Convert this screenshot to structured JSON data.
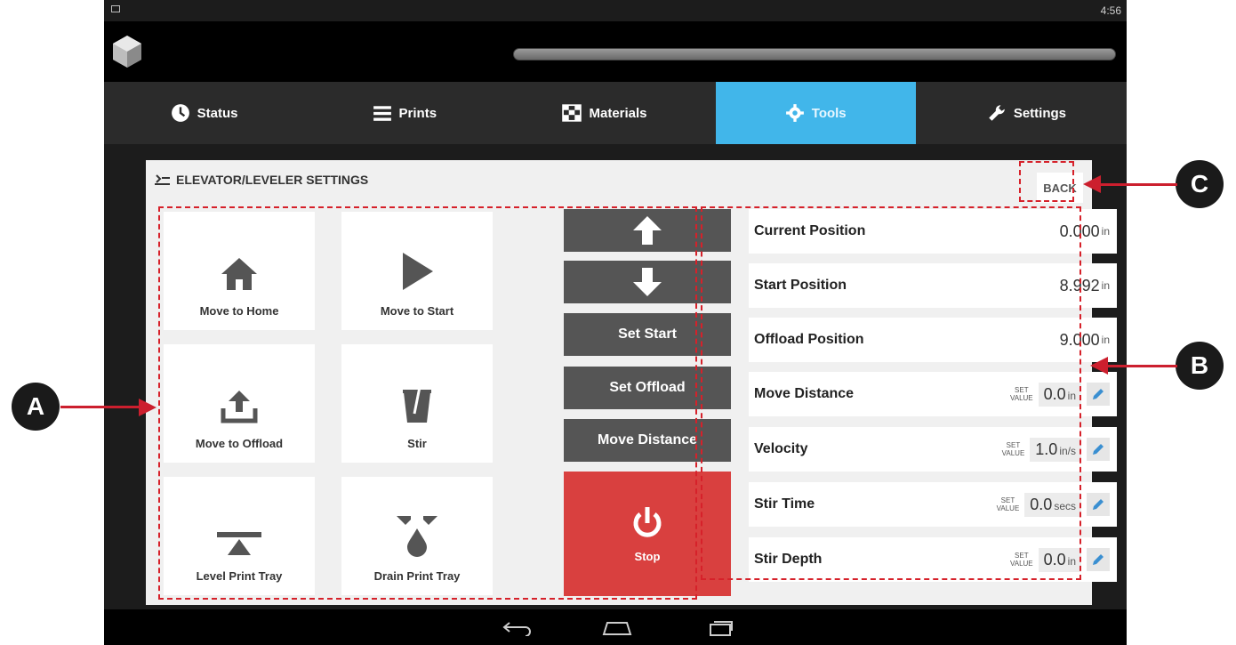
{
  "status_bar": {
    "time": "4:56"
  },
  "tabs": [
    {
      "label": "Status",
      "icon": "clock-icon"
    },
    {
      "label": "Prints",
      "icon": "menu-icon"
    },
    {
      "label": "Materials",
      "icon": "checkered-flag-icon"
    },
    {
      "label": "Tools",
      "icon": "gear-icon",
      "active": true
    },
    {
      "label": "Settings",
      "icon": "wrench-icon"
    }
  ],
  "panel": {
    "title": "ELEVATOR/LEVELER SETTINGS",
    "back_label": "BACK"
  },
  "tiles": [
    {
      "label": "Move to Home",
      "icon": "home-icon"
    },
    {
      "label": "Move to Start",
      "icon": "play-icon"
    },
    {
      "label": "Move to Offload",
      "icon": "upload-icon"
    },
    {
      "label": "Stir",
      "icon": "cup-icon"
    },
    {
      "label": "Level Print Tray",
      "icon": "level-icon"
    },
    {
      "label": "Drain Print Tray",
      "icon": "drain-icon"
    }
  ],
  "controls": {
    "up_icon": "arrow-up-icon",
    "down_icon": "arrow-down-icon",
    "set_start": "Set Start",
    "set_offload": "Set Offload",
    "move_distance": "Move Distance",
    "stop": "Stop",
    "stop_color": "#d9403f"
  },
  "readouts": [
    {
      "label": "Current Position",
      "value": "0.000",
      "unit": "in"
    },
    {
      "label": "Start Position",
      "value": "8.992",
      "unit": "in"
    },
    {
      "label": "Offload Position",
      "value": "9.000",
      "unit": "in"
    }
  ],
  "settings": [
    {
      "label": "Move Distance",
      "set_label": "SET VALUE",
      "value": "0.0",
      "unit": "in"
    },
    {
      "label": "Velocity",
      "set_label": "SET VALUE",
      "value": "1.0",
      "unit": "in/s"
    },
    {
      "label": "Stir Time",
      "set_label": "SET VALUE",
      "value": "0.0",
      "unit": "secs"
    },
    {
      "label": "Stir Depth",
      "set_label": "SET VALUE",
      "value": "0.0",
      "unit": "in"
    }
  ],
  "callouts": {
    "a": "A",
    "b": "B",
    "c": "C"
  },
  "colors": {
    "accent": "#41b6ea",
    "annotation": "#d6212a"
  }
}
